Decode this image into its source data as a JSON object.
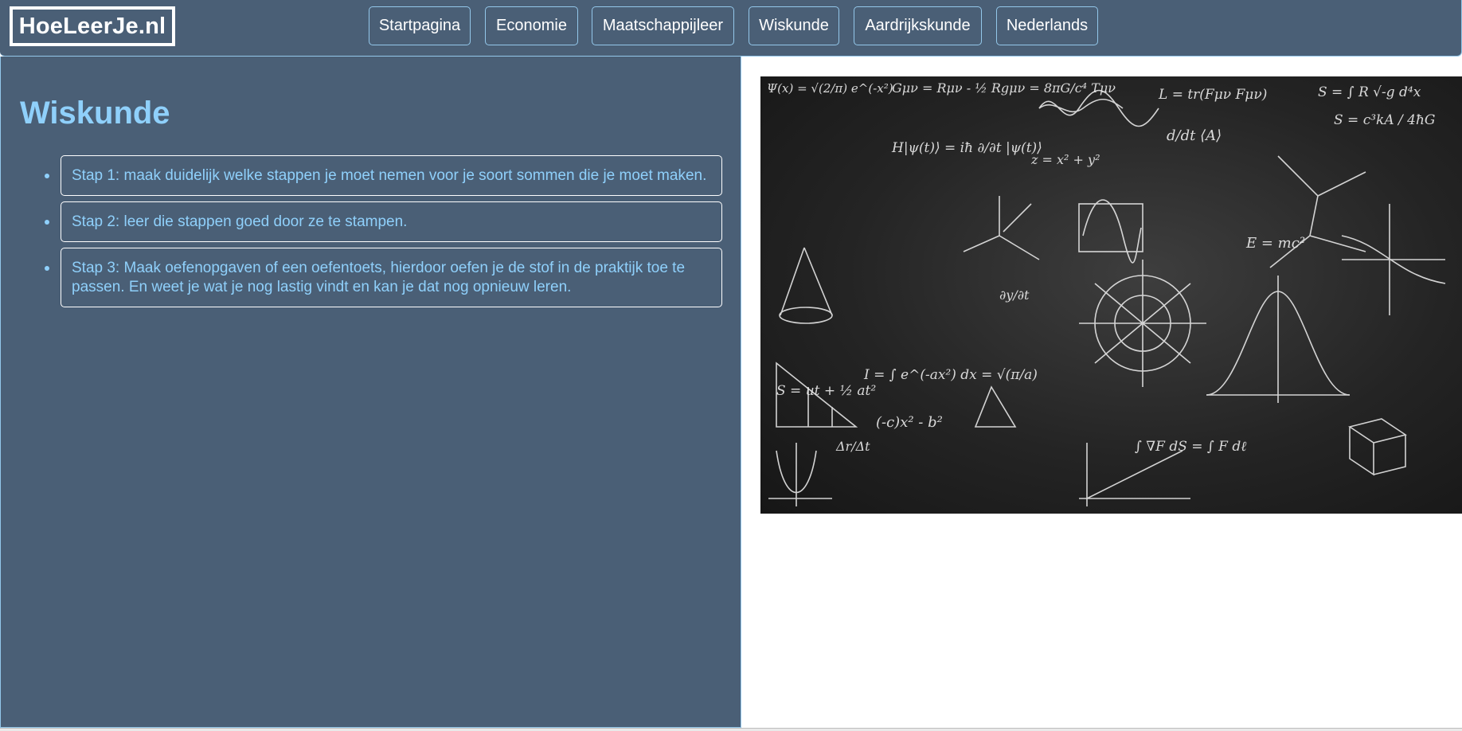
{
  "header": {
    "logo": "HoeLeerJe.nl",
    "nav": [
      {
        "label": "Startpagina"
      },
      {
        "label": "Economie"
      },
      {
        "label": "Maatschappijleer"
      },
      {
        "label": "Wiskunde"
      },
      {
        "label": "Aardrijkskunde"
      },
      {
        "label": "Nederlands"
      }
    ]
  },
  "main": {
    "title": "Wiskunde",
    "steps": [
      {
        "text": "Stap 1: maak duidelijk welke stappen je moet nemen voor je soort sommen die je moet maken."
      },
      {
        "text": "Stap 2: leer die stappen goed door ze te stampen."
      },
      {
        "text": "Stap 3: Maak oefenopgaven of een oefentoets, hierdoor oefen je de stof in de praktijk toe te passen. En weet je wat je nog lastig vindt en kan je dat nog opnieuw leren."
      }
    ]
  },
  "image": {
    "formulas": [
      "Ψ(x) = √(2/π) e^(-x²)",
      "Gμν = Rμν - ½ Rgμν = 8πG/c⁴ Tμν",
      "L = tr(Fμν Fμν)",
      "S = ∫ R √-g d⁴x",
      "S = c³kA / 4ħG",
      "H|ψ(t)⟩ = iħ ∂/∂t |ψ(t)⟩",
      "E = mc²",
      "S = ut + ½ at²",
      "I = ∫ e^(-ax²) dx = √(π/a)",
      "(-c)x² - b²",
      "∂y/∂t",
      "Δr/Δt",
      "∫ ∇F dS = ∫ F dℓ",
      "d/dt ⟨A⟩",
      "z = x² + y²"
    ]
  }
}
